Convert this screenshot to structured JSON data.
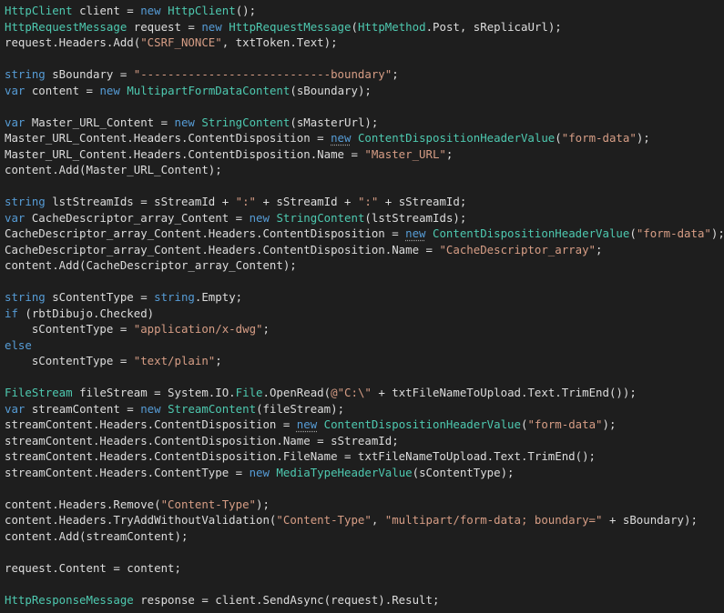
{
  "editor": {
    "theme": {
      "background": "#1e1e1e",
      "text": "#dcdcdc",
      "keyword": "#569cd6",
      "type": "#4ec9b0",
      "string": "#d69d85",
      "squiggle": "#a0a0a0"
    },
    "lines": [
      [
        [
          "HttpClient",
          "type"
        ],
        [
          " client = ",
          "text"
        ],
        [
          "new",
          "keyword"
        ],
        [
          " ",
          "text"
        ],
        [
          "HttpClient",
          "type"
        ],
        [
          "();",
          "text"
        ]
      ],
      [
        [
          "HttpRequestMessage",
          "type"
        ],
        [
          " request = ",
          "text"
        ],
        [
          "new",
          "keyword"
        ],
        [
          " ",
          "text"
        ],
        [
          "HttpRequestMessage",
          "type"
        ],
        [
          "(",
          "text"
        ],
        [
          "HttpMethod",
          "type"
        ],
        [
          ".Post, sReplicaUrl);",
          "text"
        ]
      ],
      [
        [
          "request.Headers.Add(",
          "text"
        ],
        [
          "\"CSRF_NONCE\"",
          "string"
        ],
        [
          ", txtToken.Text);",
          "text"
        ]
      ],
      [],
      [
        [
          "string",
          "keyword"
        ],
        [
          " sBoundary = ",
          "text"
        ],
        [
          "\"----------------------------boundary\"",
          "string"
        ],
        [
          ";",
          "text"
        ]
      ],
      [
        [
          "var",
          "keyword"
        ],
        [
          " content = ",
          "text"
        ],
        [
          "new",
          "keyword"
        ],
        [
          " ",
          "text"
        ],
        [
          "MultipartFormDataContent",
          "type"
        ],
        [
          "(sBoundary);",
          "text"
        ]
      ],
      [],
      [
        [
          "var",
          "keyword"
        ],
        [
          " Master_URL_Content = ",
          "text"
        ],
        [
          "new",
          "keyword"
        ],
        [
          " ",
          "text"
        ],
        [
          "StringContent",
          "type"
        ],
        [
          "(sMasterUrl);",
          "text"
        ]
      ],
      [
        [
          "Master_URL_Content.Headers.ContentDisposition = ",
          "text"
        ],
        [
          "new",
          "keyword",
          "squiggle"
        ],
        [
          " ",
          "text"
        ],
        [
          "ContentDispositionHeaderValue",
          "type"
        ],
        [
          "(",
          "text"
        ],
        [
          "\"form-data\"",
          "string"
        ],
        [
          ");",
          "text"
        ]
      ],
      [
        [
          "Master_URL_Content.Headers.ContentDisposition.Name = ",
          "text"
        ],
        [
          "\"Master_URL\"",
          "string"
        ],
        [
          ";",
          "text"
        ]
      ],
      [
        [
          "content.Add(Master_URL_Content);",
          "text"
        ]
      ],
      [],
      [
        [
          "string",
          "keyword"
        ],
        [
          " lstStreamIds = sStreamId + ",
          "text"
        ],
        [
          "\":\"",
          "string"
        ],
        [
          " + sStreamId + ",
          "text"
        ],
        [
          "\":\"",
          "string"
        ],
        [
          " + sStreamId;",
          "text"
        ]
      ],
      [
        [
          "var",
          "keyword"
        ],
        [
          " CacheDescriptor_array_Content = ",
          "text"
        ],
        [
          "new",
          "keyword"
        ],
        [
          " ",
          "text"
        ],
        [
          "StringContent",
          "type"
        ],
        [
          "(lstStreamIds);",
          "text"
        ]
      ],
      [
        [
          "CacheDescriptor_array_Content.Headers.ContentDisposition = ",
          "text"
        ],
        [
          "new",
          "keyword",
          "squiggle"
        ],
        [
          " ",
          "text"
        ],
        [
          "ContentDispositionHeaderValue",
          "type"
        ],
        [
          "(",
          "text"
        ],
        [
          "\"form-data\"",
          "string"
        ],
        [
          ");",
          "text"
        ]
      ],
      [
        [
          "CacheDescriptor_array_Content.Headers.ContentDisposition.Name = ",
          "text"
        ],
        [
          "\"CacheDescriptor_array\"",
          "string"
        ],
        [
          ";",
          "text"
        ]
      ],
      [
        [
          "content.Add(CacheDescriptor_array_Content);",
          "text"
        ]
      ],
      [],
      [
        [
          "string",
          "keyword"
        ],
        [
          " sContentType = ",
          "text"
        ],
        [
          "string",
          "keyword"
        ],
        [
          ".Empty;",
          "text"
        ]
      ],
      [
        [
          "if",
          "keyword"
        ],
        [
          " (rbtDibujo.Checked)",
          "text"
        ]
      ],
      [
        [
          "    sContentType = ",
          "text"
        ],
        [
          "\"application/x-dwg\"",
          "string"
        ],
        [
          ";",
          "text"
        ]
      ],
      [
        [
          "else",
          "keyword"
        ]
      ],
      [
        [
          "    sContentType = ",
          "text"
        ],
        [
          "\"text/plain\"",
          "string"
        ],
        [
          ";",
          "text"
        ]
      ],
      [],
      [
        [
          "FileStream",
          "type"
        ],
        [
          " fileStream = System.IO.",
          "text"
        ],
        [
          "File",
          "type"
        ],
        [
          ".OpenRead(",
          "text"
        ],
        [
          "@\"C:\\\"",
          "string"
        ],
        [
          " + txtFileNameToUpload.Text.TrimEnd());",
          "text"
        ]
      ],
      [
        [
          "var",
          "keyword"
        ],
        [
          " streamContent = ",
          "text"
        ],
        [
          "new",
          "keyword"
        ],
        [
          " ",
          "text"
        ],
        [
          "StreamContent",
          "type"
        ],
        [
          "(fileStream);",
          "text"
        ]
      ],
      [
        [
          "streamContent.Headers.ContentDisposition = ",
          "text"
        ],
        [
          "new",
          "keyword",
          "squiggle"
        ],
        [
          " ",
          "text"
        ],
        [
          "ContentDispositionHeaderValue",
          "type"
        ],
        [
          "(",
          "text"
        ],
        [
          "\"form-data\"",
          "string"
        ],
        [
          ");",
          "text"
        ]
      ],
      [
        [
          "streamContent.Headers.ContentDisposition.Name = sStreamId;",
          "text"
        ]
      ],
      [
        [
          "streamContent.Headers.ContentDisposition.FileName = txtFileNameToUpload.Text.TrimEnd();",
          "text"
        ]
      ],
      [
        [
          "streamContent.Headers.ContentType = ",
          "text"
        ],
        [
          "new",
          "keyword"
        ],
        [
          " ",
          "text"
        ],
        [
          "MediaTypeHeaderValue",
          "type"
        ],
        [
          "(sContentType);",
          "text"
        ]
      ],
      [],
      [
        [
          "content.Headers.Remove(",
          "text"
        ],
        [
          "\"Content-Type\"",
          "string"
        ],
        [
          ");",
          "text"
        ]
      ],
      [
        [
          "content.Headers.TryAddWithoutValidation(",
          "text"
        ],
        [
          "\"Content-Type\"",
          "string"
        ],
        [
          ", ",
          "text"
        ],
        [
          "\"multipart/form-data; boundary=\"",
          "string"
        ],
        [
          " + sBoundary);",
          "text"
        ]
      ],
      [
        [
          "content.Add(streamContent);",
          "text"
        ]
      ],
      [],
      [
        [
          "request.Content = content;",
          "text"
        ]
      ],
      [],
      [
        [
          "HttpResponseMessage",
          "type"
        ],
        [
          " response = client.SendAsync(request).Result;",
          "text"
        ]
      ]
    ]
  }
}
